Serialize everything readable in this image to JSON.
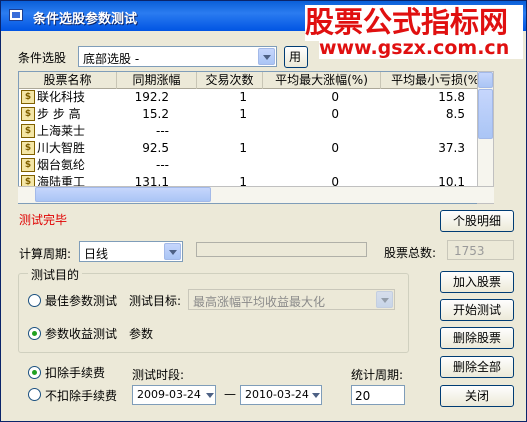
{
  "window": {
    "title": "条件选股参数测试"
  },
  "watermark": {
    "line1": "股票公式指标网",
    "line2": "www.gszx.com.cn"
  },
  "condition": {
    "label": "条件选股",
    "value": "底部选股  -",
    "btn_partial": "用"
  },
  "table": {
    "columns": [
      "股票名称",
      "同期涨幅",
      "交易次数",
      "平均最大涨幅(%)",
      "平均最小亏损(%)"
    ],
    "rows": [
      {
        "name": "联化科技",
        "gain": "192.2",
        "trades": "1",
        "avg_max": "0",
        "avg_min": "15.8",
        "icon": true
      },
      {
        "name": "步 步 高",
        "gain": "15.2",
        "trades": "1",
        "avg_max": "0",
        "avg_min": "8.5",
        "icon": true
      },
      {
        "name": "上海莱士",
        "gain": "---",
        "trades": "",
        "avg_max": "",
        "avg_min": "",
        "icon": true
      },
      {
        "name": "川大智胜",
        "gain": "92.5",
        "trades": "1",
        "avg_max": "0",
        "avg_min": "37.3",
        "icon": true
      },
      {
        "name": "烟台氨纶",
        "gain": "---",
        "trades": "",
        "avg_max": "",
        "avg_min": "",
        "icon": true
      },
      {
        "name": "海陆重工",
        "gain": "131.1",
        "trades": "1",
        "avg_max": "0",
        "avg_min": "10.1",
        "icon": true
      }
    ]
  },
  "status": {
    "text": "测试完毕",
    "color": "#e00000"
  },
  "buttons": {
    "detail": "个股明细",
    "add_stock": "加入股票",
    "start_test": "开始测试",
    "delete_stock": "删除股票",
    "delete_all": "删除全部",
    "close": "关闭"
  },
  "period": {
    "label": "计算周期:",
    "value": "日线"
  },
  "total": {
    "label": "股票总数:",
    "value": "1753"
  },
  "purpose": {
    "legend": "测试目的",
    "opt1": "最佳参数测试",
    "target_label": "测试目标:",
    "target_value": "最高涨幅平均收益最大化",
    "opt2": "参数收益测试",
    "param_label": "参数"
  },
  "fee": {
    "deduct": "扣除手续费",
    "no_deduct": "不扣除手续费"
  },
  "test_period": {
    "label": "测试时段:",
    "start": "2009-03-24",
    "sep": "—",
    "end": "2010-03-24"
  },
  "stat_period": {
    "label": "统计周期:",
    "value": "20"
  }
}
